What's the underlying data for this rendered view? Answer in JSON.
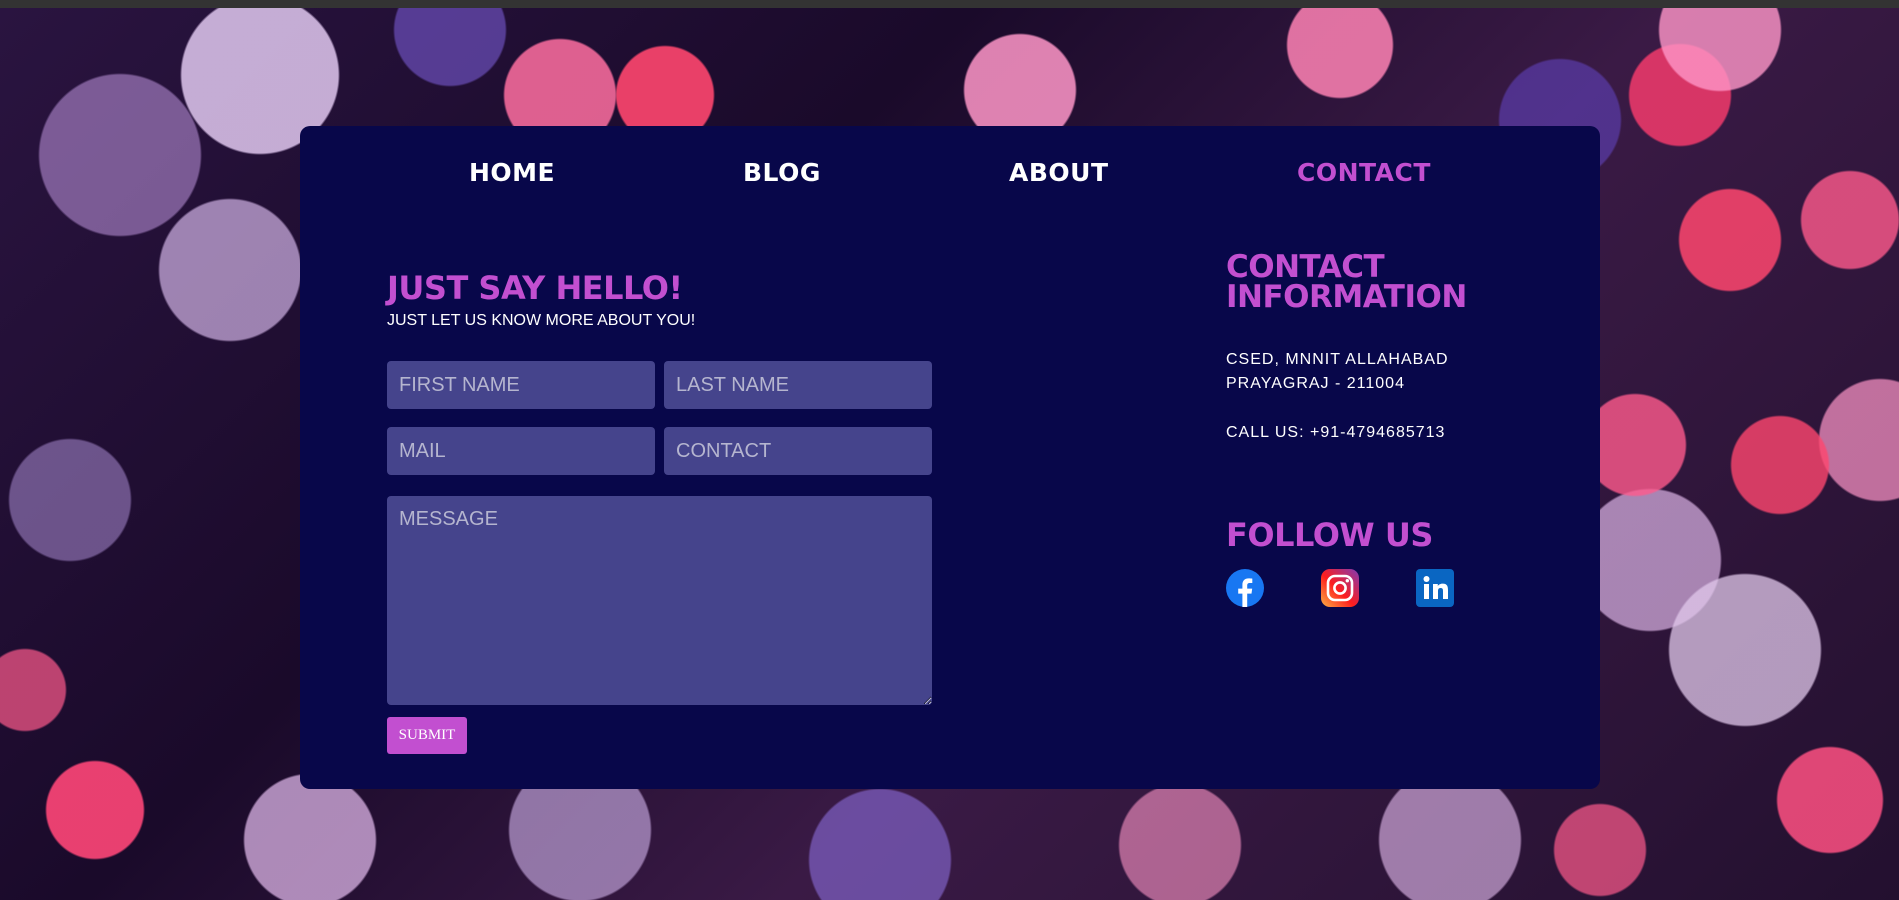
{
  "nav": {
    "home": "HOME",
    "blog": "BLOG",
    "about": "ABOUT",
    "contact": "CONTACT"
  },
  "form": {
    "title": "JUST SAY HELLO!",
    "subtitle": "JUST LET US KNOW MORE ABOUT YOU!",
    "first_name_placeholder": "FIRST NAME",
    "last_name_placeholder": "LAST NAME",
    "mail_placeholder": "MAIL",
    "contact_placeholder": "CONTACT",
    "message_placeholder": "MESSAGE",
    "submit_label": "SUBMIT"
  },
  "contact_info": {
    "title_line1": "CONTACT",
    "title_line2": "INFORMATION",
    "address_line1": "CSED, MNNIT ALLAHABAD",
    "address_line2": "PRAYAGRAJ - 211004",
    "phone": "CALL US: +91-4794685713"
  },
  "follow": {
    "title": "FOLLOW US",
    "icons": [
      "facebook-icon",
      "instagram-icon",
      "linkedin-icon"
    ]
  },
  "colors": {
    "accent": "#c24fd0",
    "card_background": "#08074a",
    "input_background": "#45448c"
  }
}
